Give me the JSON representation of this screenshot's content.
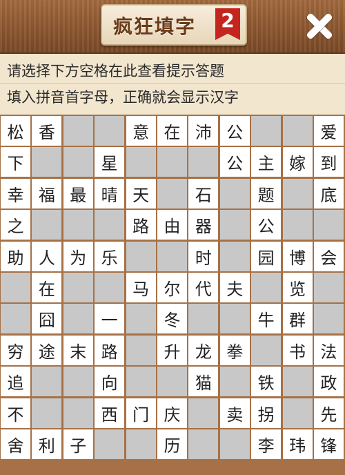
{
  "header": {
    "title": "疯狂填字",
    "level_badge": "2"
  },
  "hints": {
    "line1": "请选择下方空格在此查看提示答题",
    "line2": "填入拼音首字母，正确就会显示汉字"
  },
  "grid": {
    "columns": 11,
    "block_marker": "#",
    "rows": [
      [
        "松",
        "香",
        "#",
        "#",
        "意",
        "在",
        "沛",
        "公",
        "#",
        "#",
        "爱"
      ],
      [
        "下",
        "#",
        "#",
        "星",
        "#",
        "#",
        "#",
        "公",
        "主",
        "嫁",
        "到"
      ],
      [
        "幸",
        "福",
        "最",
        "晴",
        "天",
        "#",
        "石",
        "#",
        "题",
        "#",
        "底"
      ],
      [
        "之",
        "#",
        "#",
        "#",
        "路",
        "由",
        "器",
        "#",
        "公",
        "#",
        "#"
      ],
      [
        "助",
        "人",
        "为",
        "乐",
        "#",
        "#",
        "时",
        "#",
        "园",
        "博",
        "会"
      ],
      [
        "#",
        "在",
        "#",
        "#",
        "马",
        "尔",
        "代",
        "夫",
        "#",
        "览",
        "#"
      ],
      [
        "#",
        "囧",
        "#",
        "一",
        "#",
        "冬",
        "#",
        "#",
        "牛",
        "群",
        "#"
      ],
      [
        "穷",
        "途",
        "末",
        "路",
        "#",
        "升",
        "龙",
        "拳",
        "#",
        "书",
        "法"
      ],
      [
        "追",
        "#",
        "#",
        "向",
        "#",
        "#",
        "猫",
        "#",
        "铁",
        "#",
        "政"
      ],
      [
        "不",
        "#",
        "#",
        "西",
        "门",
        "庆",
        "#",
        "卖",
        "拐",
        "#",
        "先"
      ],
      [
        "舍",
        "利",
        "子",
        "#",
        "#",
        "历",
        "#",
        "#",
        "李",
        "玮",
        "锋"
      ]
    ]
  },
  "colors": {
    "letter_cell": "#ffffff",
    "block_cell": "#c8c8c8",
    "grid_lines": "#a67146",
    "hint_bg": "#f2e6cf"
  }
}
